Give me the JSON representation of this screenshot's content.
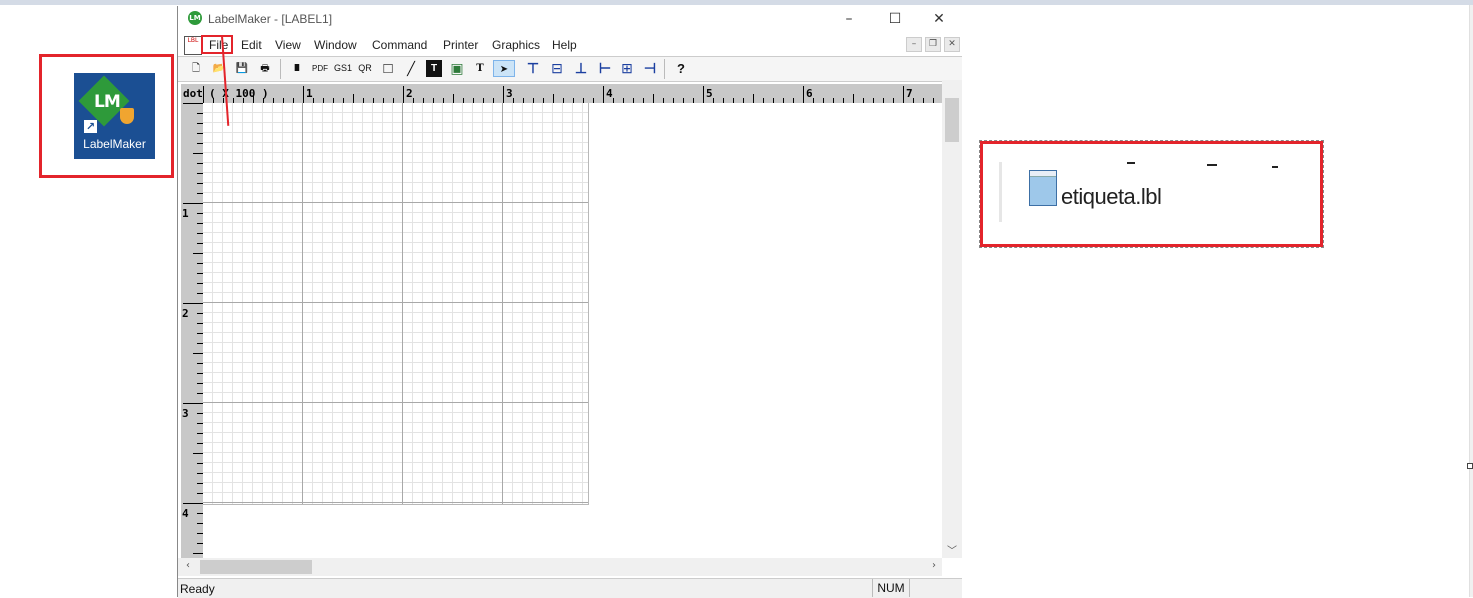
{
  "desktop": {
    "shortcut": {
      "label": "LabelMaker",
      "icon": "labelmaker-app-icon",
      "logo_text": "LM"
    }
  },
  "window": {
    "title": "LabelMaker - [LABEL1]",
    "controls": {
      "minimize": "–",
      "maximize": "☐",
      "close": "✕"
    },
    "menu": [
      "File",
      "Edit",
      "View",
      "Window",
      "Command",
      "Printer",
      "Graphics",
      "Help"
    ],
    "doc_icon_text": "LBL",
    "highlighted_menu": "File"
  },
  "toolbar": {
    "buttons": [
      {
        "name": "new-icon",
        "glyph": "🗋"
      },
      {
        "name": "open-icon",
        "glyph": "📂"
      },
      {
        "name": "save-icon",
        "glyph": "💾"
      },
      {
        "name": "print-icon",
        "glyph": "🖶"
      },
      {
        "name": "barcode-tool",
        "glyph": "IIIII"
      },
      {
        "name": "pdf417-tool",
        "glyph": "PDF"
      },
      {
        "name": "gs1-tool",
        "glyph": "GS1"
      },
      {
        "name": "qr-tool",
        "glyph": "QR"
      },
      {
        "name": "rectangle-tool",
        "glyph": "□"
      },
      {
        "name": "line-tool",
        "glyph": "╱"
      },
      {
        "name": "text-box-tool",
        "glyph": "T"
      },
      {
        "name": "image-tool",
        "glyph": "▣"
      },
      {
        "name": "text-tool",
        "glyph": "T"
      },
      {
        "name": "pointer-tool",
        "glyph": "➤"
      },
      {
        "name": "align-top-tool",
        "glyph": "⊤"
      },
      {
        "name": "align-middle-tool",
        "glyph": "⊟"
      },
      {
        "name": "align-bottom-tool",
        "glyph": "⊥"
      },
      {
        "name": "align-left-tool",
        "glyph": "⊢"
      },
      {
        "name": "align-center-tool",
        "glyph": "⊞"
      },
      {
        "name": "align-right-tool",
        "glyph": "⊣"
      },
      {
        "name": "help-icon",
        "glyph": "?"
      }
    ]
  },
  "ruler": {
    "unit_label": "dot",
    "scale_label": "( X 100 )",
    "h_marks": [
      "1",
      "2",
      "3",
      "4",
      "5",
      "6",
      "7"
    ],
    "v_marks": [
      "1",
      "2",
      "3",
      "4"
    ]
  },
  "status": {
    "ready": "Ready",
    "num": "NUM"
  },
  "file_item": {
    "name": "etiqueta.lbl",
    "icon": "lbl-file-icon"
  }
}
